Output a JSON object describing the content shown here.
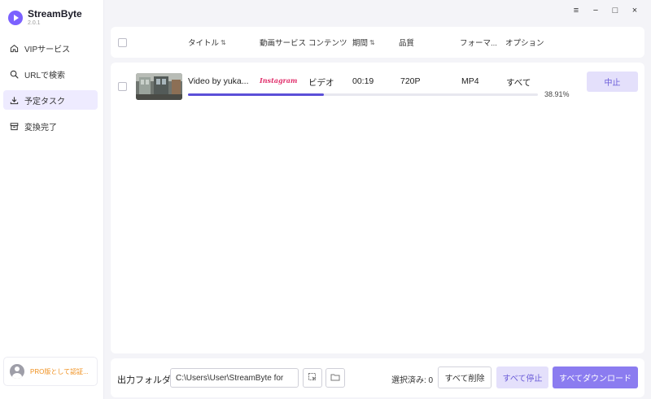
{
  "app": {
    "name": "StreamByte",
    "version": "2.0.1"
  },
  "sidebar": {
    "items": [
      {
        "label": "VIPサービス",
        "icon": "home-icon",
        "active": false
      },
      {
        "label": "URLで検索",
        "icon": "search-icon",
        "active": false
      },
      {
        "label": "予定タスク",
        "icon": "download-icon",
        "active": true
      },
      {
        "label": "変換完了",
        "icon": "archive-icon",
        "active": false
      }
    ],
    "pro_label": "PRO版として認証..."
  },
  "window_controls": {
    "menu": "≡",
    "minimize": "−",
    "maximize": "□",
    "close": "×"
  },
  "table": {
    "headers": {
      "title": "タイトル",
      "service": "動画サービス",
      "content": "コンテンツ",
      "duration": "期間",
      "quality": "品質",
      "format": "フォーマ...",
      "options": "オプション"
    },
    "rows": [
      {
        "title": "Video by yuka...",
        "service": "Instagram",
        "content": "ビデオ",
        "duration": "00:19",
        "quality": "720P",
        "format": "MP4",
        "options": "すべて",
        "progress": 38.91,
        "progress_label": "38.91%",
        "action": "中止"
      }
    ]
  },
  "footer": {
    "output_label": "出力フォルダ",
    "output_path": "C:\\Users\\User\\StreamByte for",
    "selected_label": "選択済み: 0",
    "delete_all": "すべて削除",
    "stop_all": "すべて停止",
    "download_all": "すべてダウンロード"
  },
  "colors": {
    "accent": "#8b7cf0",
    "accent_light": "#e4e0fb",
    "progress": "#5b4fd8",
    "pro": "#f0901e"
  }
}
